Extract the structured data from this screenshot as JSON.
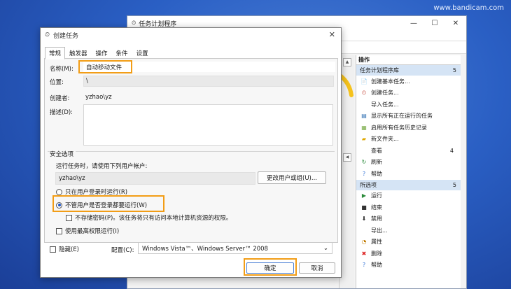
{
  "watermark": "www.bandicam.com",
  "back_window": {
    "title": "任务计划程序",
    "controls": [
      "—",
      "☐",
      "✕"
    ],
    "actions_header": "操作",
    "section1": {
      "label": "任务计划程序库",
      "count": "5"
    },
    "items1": [
      {
        "icon": "doc-icon",
        "label": "创建基本任务..."
      },
      {
        "icon": "task-icon",
        "label": "创建任务..."
      },
      {
        "icon": "",
        "label": "导入任务..."
      },
      {
        "icon": "list-icon",
        "label": "显示所有正在运行的任务"
      },
      {
        "icon": "history-icon",
        "label": "启用所有任务历史记录"
      },
      {
        "icon": "folder-icon",
        "label": "新文件夹..."
      },
      {
        "icon": "",
        "label": "查看",
        "count": "4"
      },
      {
        "icon": "refresh-icon",
        "label": "刷新"
      },
      {
        "icon": "help-icon",
        "label": "帮助"
      }
    ],
    "section2": {
      "label": "所选项",
      "count": "5"
    },
    "items2": [
      {
        "icon": "run-icon",
        "label": "运行"
      },
      {
        "icon": "stop-icon",
        "label": "结束"
      },
      {
        "icon": "disable-icon",
        "label": "禁用"
      },
      {
        "icon": "",
        "label": "导出..."
      },
      {
        "icon": "properties-icon",
        "label": "属性"
      },
      {
        "icon": "delete-icon",
        "label": "删除"
      },
      {
        "icon": "help-icon",
        "label": "帮助"
      }
    ]
  },
  "dialog": {
    "title": "创建任务",
    "tabs": [
      "常规",
      "触发器",
      "操作",
      "条件",
      "设置"
    ],
    "name_label": "名称(M):",
    "name_value": "自动移动文件",
    "location_label": "位置:",
    "location_value": "\\",
    "author_label": "创建者:",
    "author_value": "yzhao\\yz",
    "desc_label": "描述(D):",
    "security_title": "安全选项",
    "run_as_text": "运行任务时，请使用下列用户帐户:",
    "user_value": "yzhao\\yz",
    "change_user_btn": "更改用户或组(U)...",
    "radio_logged_on": "只在用户登录时运行(R)",
    "radio_whether": "不管用户是否登录都要运行(W)",
    "no_store_pwd": "不存储密码(P)。该任务将只有访问本地计算机资源的权限。",
    "highest_priv": "使用最高权限运行(I)",
    "hidden_label": "隐藏(E)",
    "config_label": "配置(C):",
    "config_value": "Windows Vista™、Windows Server™ 2008",
    "ok_btn": "确定",
    "cancel_btn": "取消"
  },
  "colors": {
    "highlight": "#f29d16",
    "arrow": "#f5c21c",
    "selection": "#d5e4f5"
  }
}
